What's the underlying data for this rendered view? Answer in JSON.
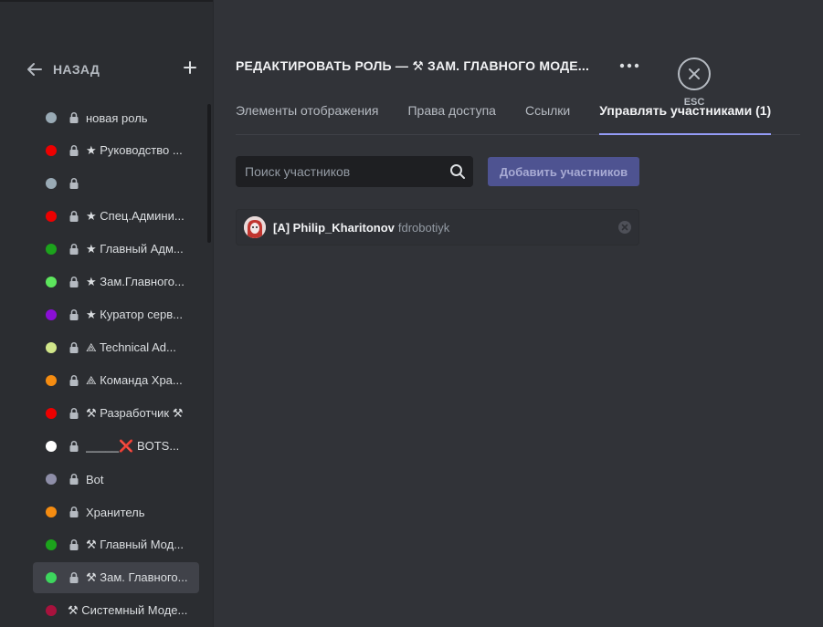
{
  "sidebar": {
    "back_label": "НАЗАД",
    "roles": [
      {
        "name": "новая роль",
        "color": "#99aab5",
        "locked": true
      },
      {
        "name": "★ Руководство ...",
        "color": "#ed0000",
        "locked": true
      },
      {
        "name": "",
        "color": "#99aab5",
        "locked": true
      },
      {
        "name": "★ Спец.Админи...",
        "color": "#ed0000",
        "locked": true
      },
      {
        "name": "★ Главный Адм...",
        "color": "#1ca31c",
        "locked": true
      },
      {
        "name": "★ Зам.Главного...",
        "color": "#5de65d",
        "locked": true
      },
      {
        "name": "★ Куратор серв...",
        "color": "#8a0fd6",
        "locked": true
      },
      {
        "name": "⟁ Technical Ad...",
        "color": "#d1e68a",
        "locked": true
      },
      {
        "name": "⟁ Команда Хра...",
        "color": "#f58c11",
        "locked": true
      },
      {
        "name": "⚒ Разработчик ⚒",
        "color": "#ed0000",
        "locked": true
      },
      {
        "name": "_____❌ BOTS...",
        "color": "#ffffff",
        "locked": true
      },
      {
        "name": "Bot",
        "color": "#8e8ea8",
        "locked": true
      },
      {
        "name": "Хранитель",
        "color": "#f58c11",
        "locked": true
      },
      {
        "name": "⚒ Главный Мод...",
        "color": "#1ca31c",
        "locked": true
      },
      {
        "name": "⚒ Зам. Главного...",
        "color": "#3dd65d",
        "locked": true,
        "selected": true
      },
      {
        "name": "⚒ Системный Моде...",
        "color": "#a8123d",
        "locked": false
      }
    ]
  },
  "header": {
    "title": "РЕДАКТИРОВАТЬ РОЛЬ — ⚒ ЗАМ. ГЛАВНОГО МОДЕ...",
    "esc_label": "ESC"
  },
  "tabs": [
    {
      "label": "Элементы отображения"
    },
    {
      "label": "Права доступа"
    },
    {
      "label": "Ссылки"
    },
    {
      "label": "Управлять участниками (1)",
      "active": true
    }
  ],
  "search": {
    "placeholder": "Поиск участников",
    "value": ""
  },
  "add_members_label": "Добавить участников",
  "members": [
    {
      "display_name": "[A] Philip_Kharitonov",
      "username": "fdrobotiyk"
    }
  ],
  "colors": {
    "accent": "#949cf7",
    "button": "#4e5391",
    "background": "#313338",
    "sidebar": "#2b2d31"
  }
}
